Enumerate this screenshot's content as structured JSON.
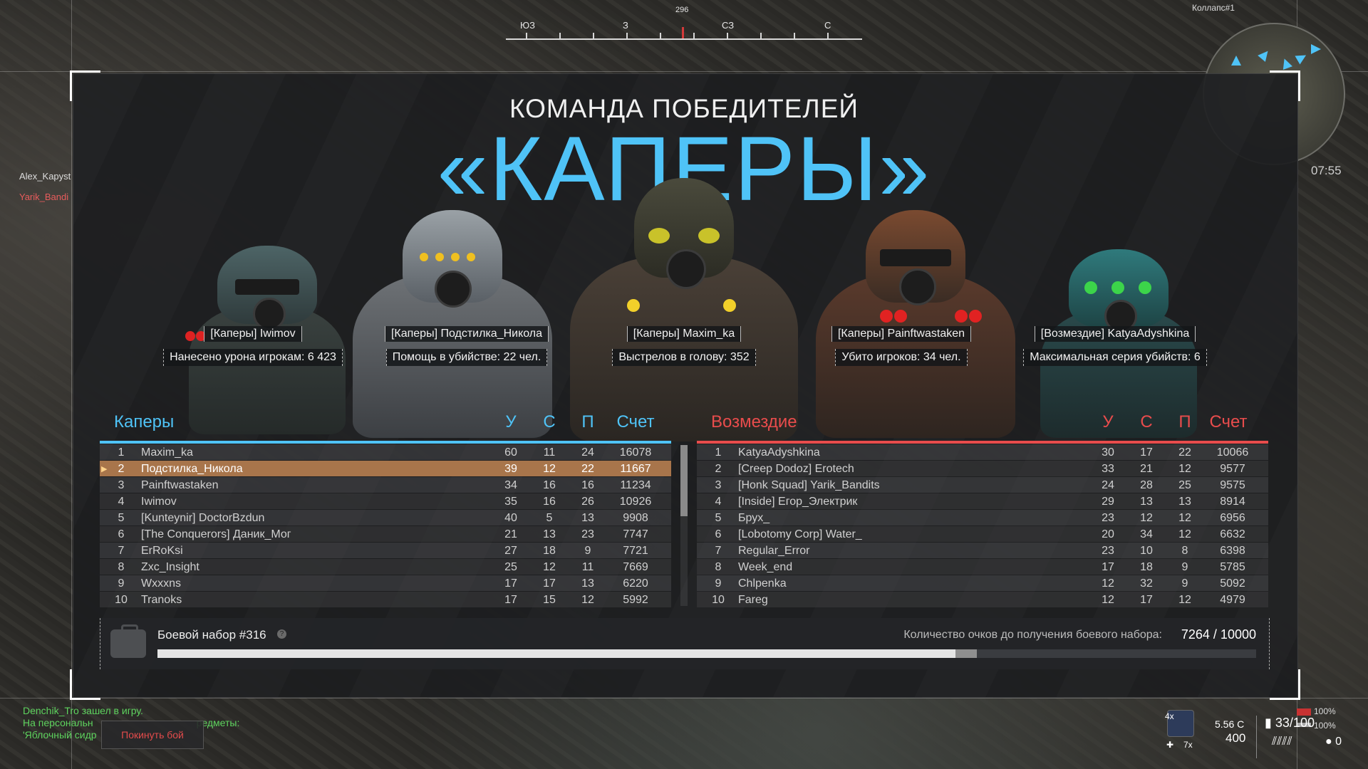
{
  "compass": {
    "heading": "296",
    "labels": [
      "ЮЗ",
      "З",
      "СЗ",
      "С"
    ]
  },
  "hud": {
    "map_label": "Коллапс#1",
    "timer": "07:55",
    "left_names": [
      "Alex_Kapyst",
      "Yarik_Bandi"
    ]
  },
  "winner": {
    "label": "КОМАНДА ПОБЕДИТЕЛЕЙ",
    "team": "«КАПЕРЫ»"
  },
  "awards": [
    {
      "name": "[Каперы] Iwimov",
      "stat": "Нанесено урона игрокам: 6 423"
    },
    {
      "name": "[Каперы] Подстилка_Никола",
      "stat": "Помощь в убийстве: 22 чел."
    },
    {
      "name": "[Каперы] Maxim_ka",
      "stat": "Выстрелов в голову: 352"
    },
    {
      "name": "[Каперы] Painftwastaken",
      "stat": "Убито игроков: 34 чел."
    },
    {
      "name": "[Возмездие] KatyaAdyshkina",
      "stat": "Максимальная серия убийств: 6"
    }
  ],
  "team_left": {
    "name": "Каперы",
    "color": "#4fc3f7",
    "cols": [
      "У",
      "С",
      "П",
      "Счет"
    ],
    "rows": [
      {
        "n": "1",
        "name": "Maxim_ka",
        "k": "60",
        "d": "11",
        "a": "24",
        "score": "16078"
      },
      {
        "n": "2",
        "name": "Подстилка_Никола",
        "k": "39",
        "d": "12",
        "a": "22",
        "score": "11667"
      },
      {
        "n": "3",
        "name": "Painftwastaken",
        "k": "34",
        "d": "16",
        "a": "16",
        "score": "11234"
      },
      {
        "n": "4",
        "name": "Iwimov",
        "k": "35",
        "d": "16",
        "a": "26",
        "score": "10926"
      },
      {
        "n": "5",
        "name": "[Kunteynir] DoctorBzdun",
        "k": "40",
        "d": "5",
        "a": "13",
        "score": "9908"
      },
      {
        "n": "6",
        "name": "[The Conquerors] Даник_Мог",
        "k": "21",
        "d": "13",
        "a": "23",
        "score": "7747"
      },
      {
        "n": "7",
        "name": "ErRoKsi",
        "k": "27",
        "d": "18",
        "a": "9",
        "score": "7721"
      },
      {
        "n": "8",
        "name": "Zxc_Insight",
        "k": "25",
        "d": "12",
        "a": "11",
        "score": "7669"
      },
      {
        "n": "9",
        "name": "Wxxxns",
        "k": "17",
        "d": "17",
        "a": "13",
        "score": "6220"
      },
      {
        "n": "10",
        "name": "Tranoks",
        "k": "17",
        "d": "15",
        "a": "12",
        "score": "5992"
      }
    ]
  },
  "team_right": {
    "name": "Возмездие",
    "color": "#e84c4c",
    "cols": [
      "У",
      "С",
      "П",
      "Счет"
    ],
    "rows": [
      {
        "n": "1",
        "name": "KatyaAdyshkina",
        "k": "30",
        "d": "17",
        "a": "22",
        "score": "10066"
      },
      {
        "n": "2",
        "name": "[Creep Dodoz] Erotech",
        "k": "33",
        "d": "21",
        "a": "12",
        "score": "9577"
      },
      {
        "n": "3",
        "name": "[Honk Squad] Yarik_Bandits",
        "k": "24",
        "d": "28",
        "a": "25",
        "score": "9575"
      },
      {
        "n": "4",
        "name": "[Inside] Егор_Электрик",
        "k": "29",
        "d": "13",
        "a": "13",
        "score": "8914"
      },
      {
        "n": "5",
        "name": "Брух_",
        "k": "23",
        "d": "12",
        "a": "12",
        "score": "6956"
      },
      {
        "n": "6",
        "name": "[Lobotomy Corp] Water_",
        "k": "20",
        "d": "34",
        "a": "12",
        "score": "6632"
      },
      {
        "n": "7",
        "name": "Regular_Error",
        "k": "23",
        "d": "10",
        "a": "8",
        "score": "6398"
      },
      {
        "n": "8",
        "name": "Week_end",
        "k": "17",
        "d": "18",
        "a": "9",
        "score": "5785"
      },
      {
        "n": "9",
        "name": "Chlpenka",
        "k": "12",
        "d": "32",
        "a": "9",
        "score": "5092"
      },
      {
        "n": "10",
        "name": "Fareg",
        "k": "12",
        "d": "17",
        "a": "12",
        "score": "4979"
      }
    ]
  },
  "kit": {
    "title": "Боевой набор #316",
    "points_label": "Количество очков до получения боевого набора:",
    "points_value": "7264 / 10000",
    "progress": 0.7264,
    "progress_extra": 0.0196
  },
  "chat": {
    "lines": [
      "Denchik_Tro зашел в игру.",
      "На персональн",
      "'Яблочный сидр"
    ],
    "line_tail": "редметы:",
    "leave_button": "Покинуть бой"
  },
  "weapon": {
    "caliber": "5.56 C",
    "reserve": "400",
    "ammo": "33/100",
    "grenades": "0",
    "medkits_x": "4x",
    "stim_x": "7x",
    "hp": "100%",
    "armor": "100%"
  }
}
